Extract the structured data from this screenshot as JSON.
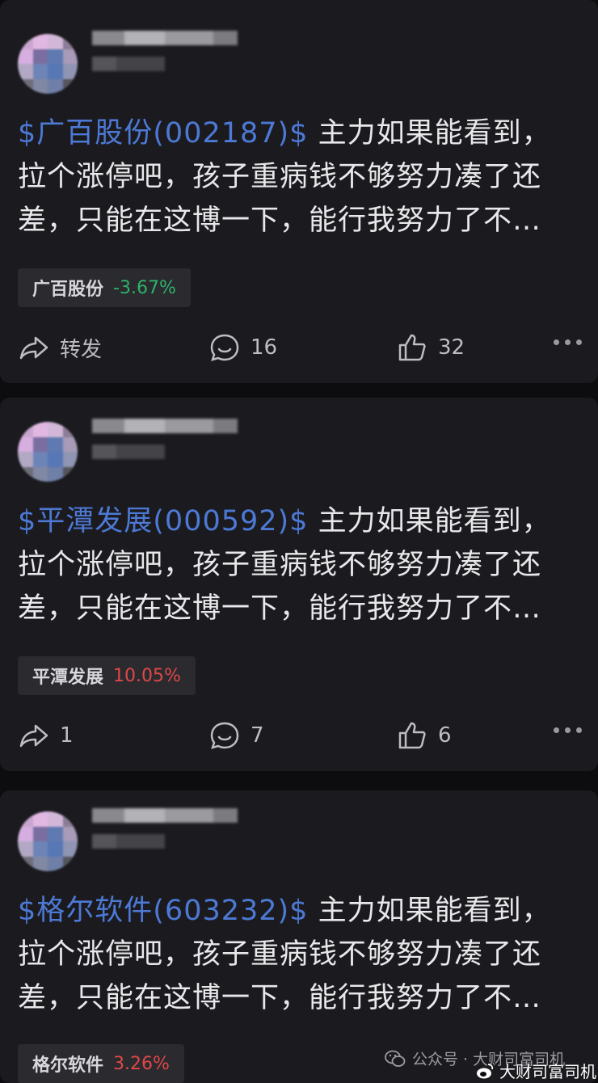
{
  "posts": [
    {
      "stock_link": "$广百股份(002187)$",
      "text_line1_rest": " 主力如果能看到，",
      "text_line2": "拉个涨停吧，孩子重病钱不够努力凑了还",
      "text_line3": "差，只能在这博一下，能行我努力了不…",
      "tag_name": "广百股份",
      "tag_pct": "-3.67%",
      "forward": "转发",
      "comments": "16",
      "likes": "32"
    },
    {
      "stock_link": "$平潭发展(000592)$",
      "text_line1_rest": " 主力如果能看到，",
      "text_line2": "拉个涨停吧，孩子重病钱不够努力凑了还",
      "text_line3": "差，只能在这博一下，能行我努力了不…",
      "tag_name": "平潭发展",
      "tag_pct": "10.05%",
      "forward": "1",
      "comments": "7",
      "likes": "6"
    },
    {
      "stock_link": "$格尔软件(603232)$",
      "text_line1_rest": " 主力如果能看到，",
      "text_line2": "拉个涨停吧，孩子重病钱不够努力凑了还",
      "text_line3": "差，只能在这博一下，能行我努力了不…",
      "tag_name": "格尔软件",
      "tag_pct": "3.26%"
    }
  ],
  "watermark": {
    "wechat": "公众号 · 大财司富司机",
    "weibo": "大财司富司机"
  },
  "icons": {
    "share": "share-icon",
    "comment": "comment-icon",
    "like": "thumbs-up-icon",
    "more": "more-icon"
  },
  "colors": {
    "background": "#0d0d0f",
    "card": "#1b1b1f",
    "link": "#4d79d6",
    "down": "#2db36a",
    "up": "#e04848"
  }
}
